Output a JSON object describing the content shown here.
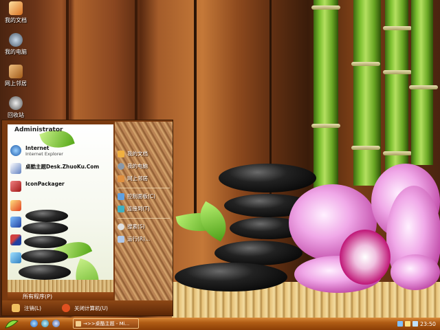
{
  "desktop": {
    "icons": [
      {
        "label": "我的文档",
        "icon": "documents-folder-icon"
      },
      {
        "label": "我的电脑",
        "icon": "computer-icon"
      },
      {
        "label": "网上邻居",
        "icon": "network-icon"
      },
      {
        "label": "回收站",
        "icon": "recycle-bin-icon"
      }
    ]
  },
  "start_menu": {
    "user": "Administrator",
    "pinned": [
      {
        "title": "Internet",
        "subtitle": "Internet Explorer",
        "icon": "ie-icon"
      },
      {
        "title": "桌酷主题Desk.ZhuoKu.Com",
        "subtitle": "",
        "icon": "theme-icon"
      },
      {
        "title": "IconPackager",
        "subtitle": "",
        "icon": "iconpackager-icon"
      }
    ],
    "recent_icons": [
      "paint-icon",
      "monitor-icon",
      "flag-icon",
      "notepad-icon"
    ],
    "all_programs": "所有程序(P)",
    "right": [
      {
        "label": "我的文档",
        "icon": "documents-folder-icon"
      },
      {
        "label": "我的电脑",
        "icon": "computer-icon"
      },
      {
        "label": "网上邻居",
        "icon": "network-icon"
      },
      {
        "label": "控制面板(C)",
        "icon": "control-panel-icon"
      },
      {
        "label": "连接到(T)",
        "icon": "connect-icon"
      },
      {
        "label": "搜索(S)",
        "icon": "search-icon"
      },
      {
        "label": "运行(R)...",
        "icon": "run-icon"
      }
    ],
    "logoff": "注销(L)",
    "shutdown": "关闭计算机(U)"
  },
  "taskbar": {
    "task_button": "→>>桌酷主题 - Mi...",
    "clock": "23:50"
  },
  "colors": {
    "accent": "#b05c14",
    "menu_frame": "#7a3a10",
    "text_light": "#ffffff"
  }
}
